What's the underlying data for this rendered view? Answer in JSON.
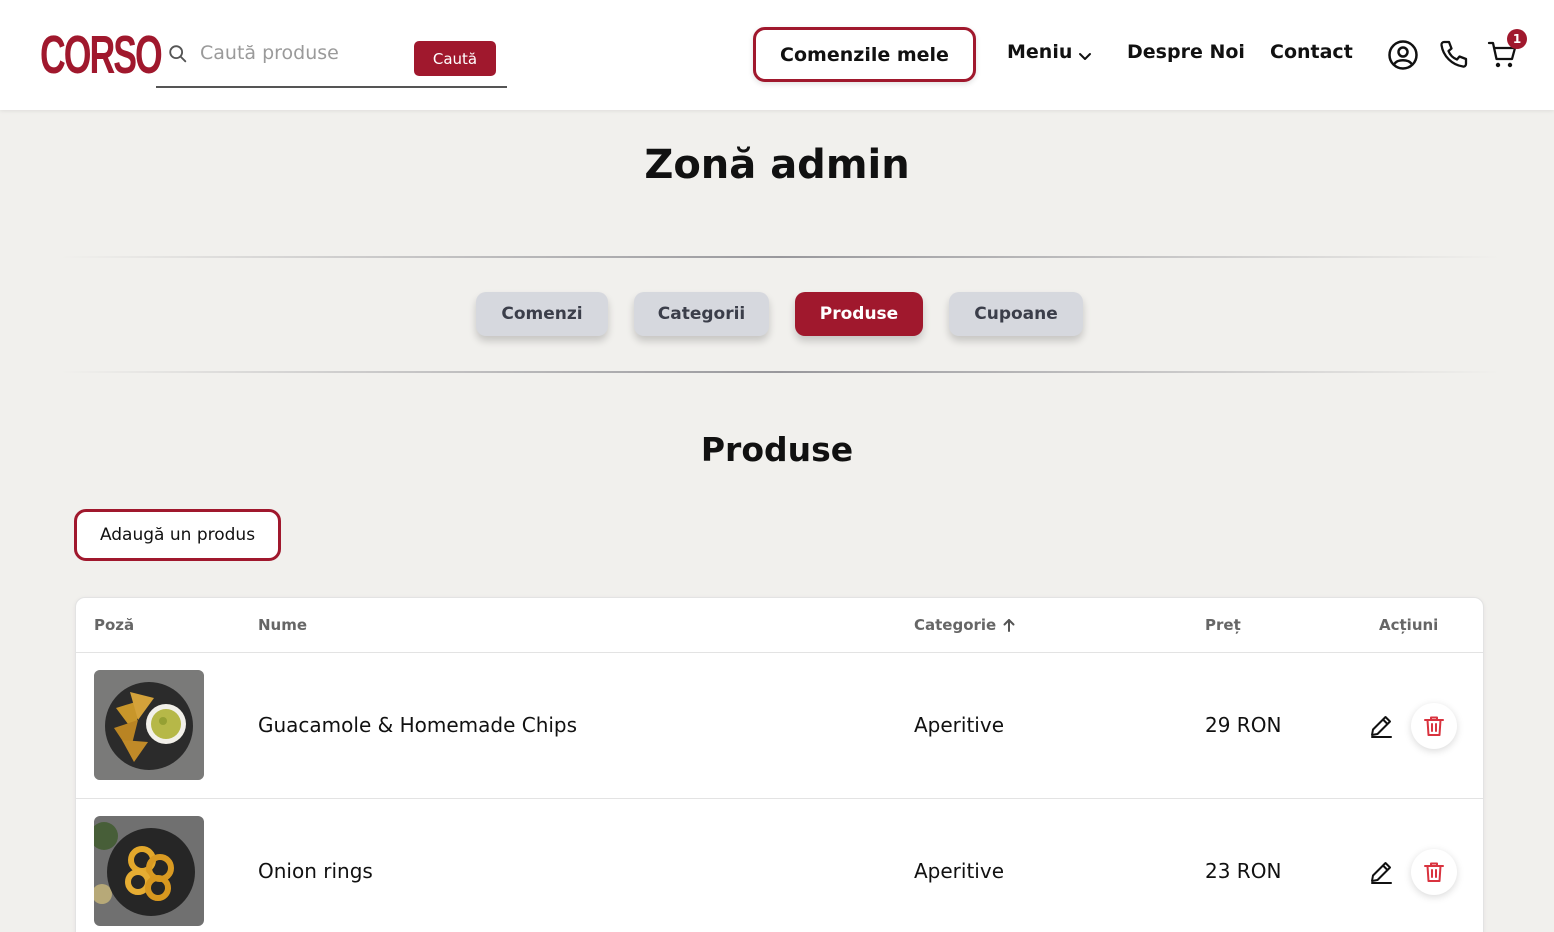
{
  "header": {
    "logo_text": "CORSO",
    "search": {
      "placeholder": "Caută produse",
      "button_label": "Caută"
    },
    "orders_button": "Comenzile mele",
    "nav": {
      "menu": "Meniu",
      "about": "Despre Noi",
      "contact": "Contact"
    },
    "icons": [
      "search-icon",
      "chevron-down-icon",
      "user-icon",
      "phone-icon",
      "cart-icon"
    ],
    "cart_count": "1"
  },
  "page": {
    "title": "Zonă admin",
    "tabs": [
      {
        "label": "Comenzi",
        "active": false
      },
      {
        "label": "Categorii",
        "active": false
      },
      {
        "label": "Produse",
        "active": true
      },
      {
        "label": "Cupoane",
        "active": false
      }
    ],
    "section_title": "Produse",
    "add_button": "Adaugă un produs"
  },
  "table": {
    "headers": {
      "photo": "Poză",
      "name": "Nume",
      "category": "Categorie",
      "price": "Preț",
      "actions": "Acțiuni"
    },
    "sort": {
      "column": "category",
      "direction": "ascending",
      "icon": "arrow-up-icon"
    },
    "rows": [
      {
        "name": "Guacamole & Homemade Chips",
        "category": "Aperitive",
        "price": "29 RON"
      },
      {
        "name": "Onion rings",
        "category": "Aperitive",
        "price": "23 RON"
      }
    ]
  },
  "colors": {
    "brand": "#a0182d",
    "background": "#f1f0ed",
    "tab_inactive": "#d6d8de"
  }
}
